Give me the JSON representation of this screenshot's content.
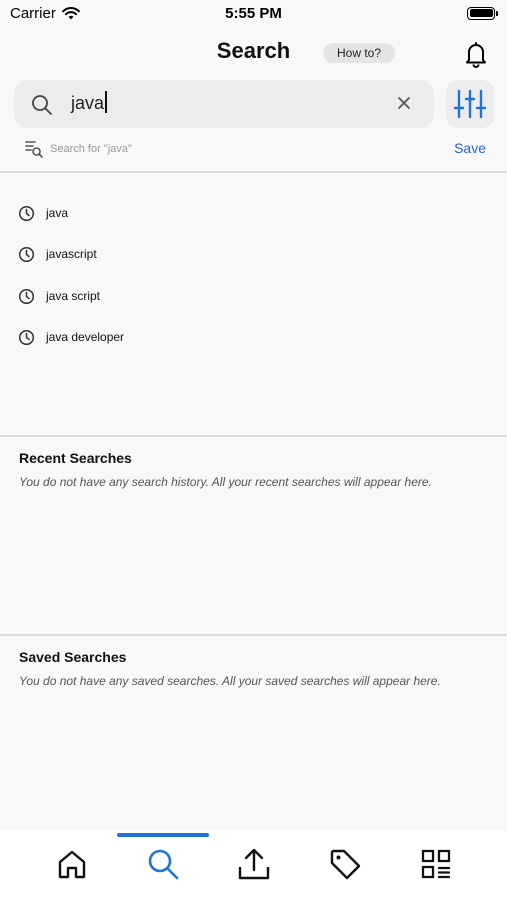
{
  "status_bar": {
    "carrier": "Carrier",
    "time": "5:55 PM"
  },
  "header": {
    "title": "Search",
    "howto_label": "How to?"
  },
  "search": {
    "value": "java",
    "search_for_text": "Search for \"java\"",
    "save_label": "Save"
  },
  "suggestions": [
    {
      "label": "java"
    },
    {
      "label": "javascript"
    },
    {
      "label": "java script"
    },
    {
      "label": "java developer"
    }
  ],
  "recent": {
    "title": "Recent Searches",
    "empty_text": "You do not have any search history. All your recent searches will appear here."
  },
  "saved": {
    "title": "Saved Searches",
    "empty_text": "You do not have any saved searches. All your saved searches will appear here."
  },
  "colors": {
    "accent": "#1e74d8",
    "link": "#2266cc",
    "background": "#f8f8f8"
  },
  "tabs": [
    {
      "icon": "home-icon",
      "active": false
    },
    {
      "icon": "search-icon",
      "active": true
    },
    {
      "icon": "upload-icon",
      "active": false
    },
    {
      "icon": "tag-icon",
      "active": false
    },
    {
      "icon": "grid-menu-icon",
      "active": false
    }
  ]
}
